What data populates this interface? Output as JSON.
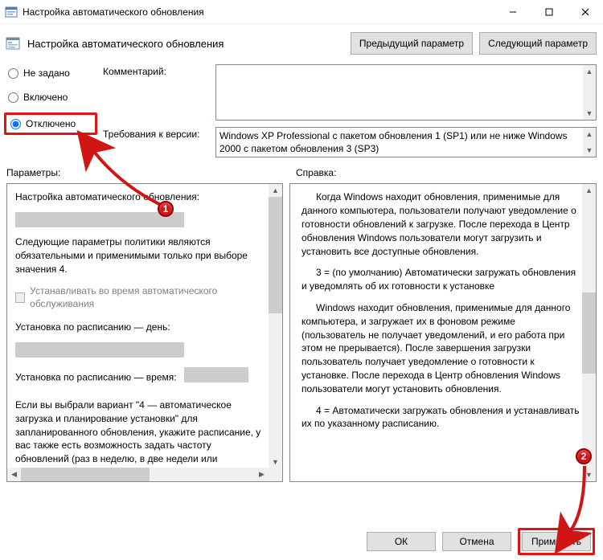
{
  "window": {
    "title": "Настройка автоматического обновления"
  },
  "header": {
    "title": "Настройка автоматического обновления",
    "prev": "Предыдущий параметр",
    "next": "Следующий параметр"
  },
  "radios": {
    "not_configured": "Не задано",
    "enabled": "Включено",
    "disabled": "Отключено"
  },
  "fields": {
    "comment_label": "Комментарий:",
    "req_label": "Требования к версии:",
    "req_text": "Windows XP Professional с пакетом обновления 1 (SP1) или не ниже Windows 2000 с пакетом обновления 3 (SP3)"
  },
  "sections": {
    "params": "Параметры:",
    "help": "Справка:"
  },
  "params": {
    "heading": "Настройка автоматического обновления:",
    "policy_note": "Следующие параметры политики являются обязательными и применимыми только при выборе значения 4.",
    "chk_label": "Устанавливать во время автоматического обслуживания",
    "day_label": "Установка по расписанию — день:",
    "time_label": "Установка по расписанию — время:",
    "tail": "Если вы выбрали вариант \"4 — автоматическое загрузка и планирование установки\" для запланированного обновления, укажите расписание, у вас также есть возможность задать частоту обновлений (раз в неделю, в две недели или ежемесячно), используя варианты, описанные ниже."
  },
  "help": {
    "p1": "Когда Windows находит обновления, применимые для данного компьютера, пользователи получают уведомление о готовности обновлений к загрузке. После перехода в Центр обновления Windows пользователи могут загрузить и установить все доступные обновления.",
    "p2": "3 = (по умолчанию) Автоматически загружать обновления и уведомлять об их готовности к установке",
    "p3": "Windows находит обновления, применимые для данного компьютера, и загружает их в фоновом режиме (пользователь не получает уведомлений, и его работа при этом не прерывается). После завершения загрузки пользователь получает уведомление о готовности к установке. После перехода в Центр обновления Windows пользователи могут установить обновления.",
    "p4": "4 = Автоматически загружать обновления и устанавливать их по указанному расписанию."
  },
  "buttons": {
    "ok": "ОК",
    "cancel": "Отмена",
    "apply": "Применить"
  },
  "markers": {
    "one": "1",
    "two": "2"
  }
}
